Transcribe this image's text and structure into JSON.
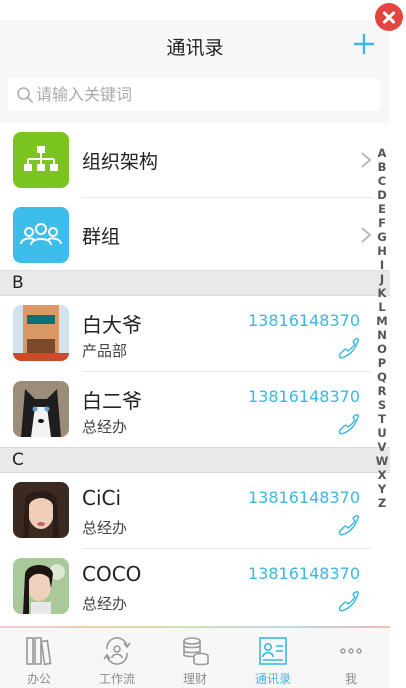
{
  "header": {
    "title": "通讯录"
  },
  "search": {
    "placeholder": "请输入关键词"
  },
  "groups": [
    {
      "label": "组织架构",
      "icon": "org-chart-icon",
      "color": "#7cc520"
    },
    {
      "label": "群组",
      "icon": "group-icon",
      "color": "#3dbde9"
    }
  ],
  "sections": [
    {
      "letter": "B",
      "contacts": [
        {
          "name": "白大爷",
          "dept": "产品部",
          "phone": "13816148370"
        },
        {
          "name": "白二爷",
          "dept": "总经办",
          "phone": "13816148370"
        }
      ]
    },
    {
      "letter": "C",
      "contacts": [
        {
          "name": "CiCi",
          "dept": "总经办",
          "phone": "13816148370"
        },
        {
          "name": "COCO",
          "dept": "总经办",
          "phone": "13816148370"
        }
      ]
    }
  ],
  "alphabet": [
    "A",
    "B",
    "C",
    "D",
    "E",
    "F",
    "G",
    "H",
    "I",
    "J",
    "K",
    "L",
    "M",
    "N",
    "O",
    "P",
    "Q",
    "R",
    "S",
    "T",
    "U",
    "V",
    "W",
    "X",
    "Y",
    "Z"
  ],
  "tabs": [
    {
      "label": "办公",
      "icon": "books-icon",
      "active": false
    },
    {
      "label": "工作流",
      "icon": "workflow-icon",
      "active": false
    },
    {
      "label": "理财",
      "icon": "coins-icon",
      "active": false
    },
    {
      "label": "通讯录",
      "icon": "contacts-card-icon",
      "active": true
    },
    {
      "label": "我",
      "icon": "more-dots-icon",
      "active": false
    }
  ],
  "colors": {
    "accent": "#3cb7e2",
    "close": "#e2463f",
    "org": "#7cc520",
    "group": "#3dbde9"
  }
}
